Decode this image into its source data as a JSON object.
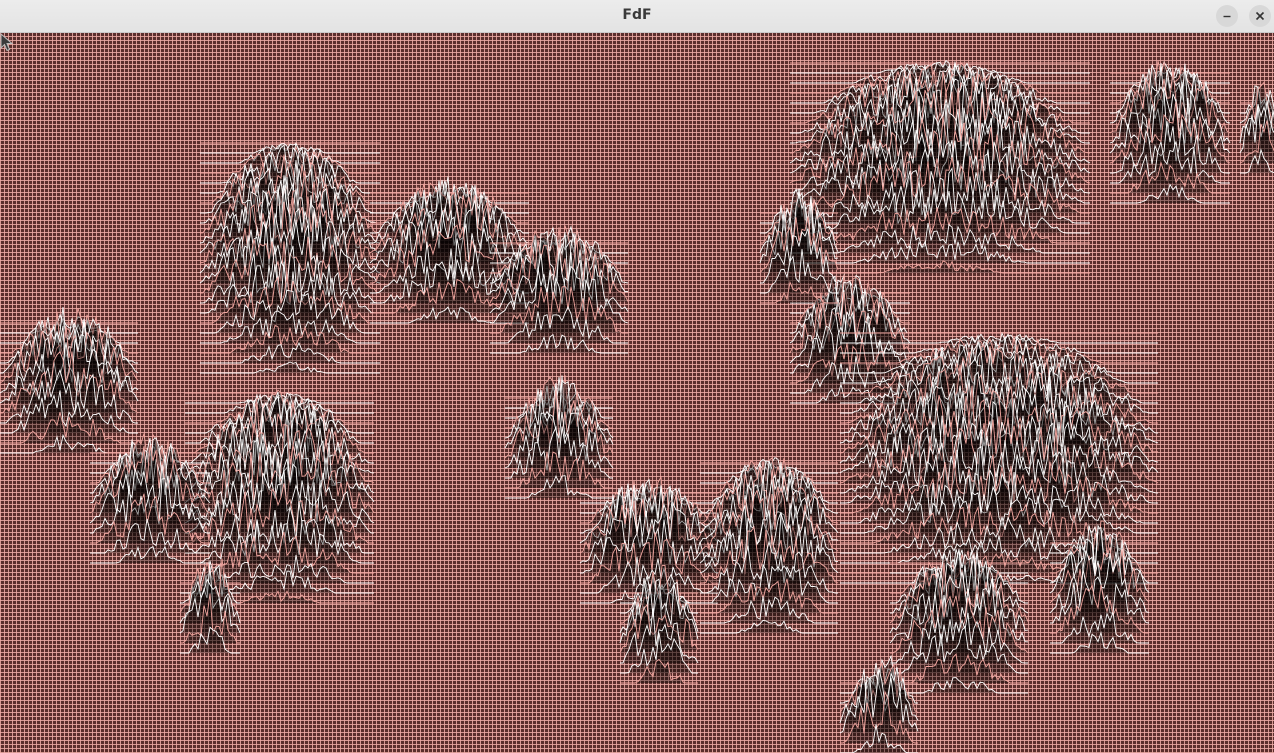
{
  "window": {
    "title": "FdF",
    "minimize_icon": "minimize-icon",
    "close_icon": "close-icon"
  },
  "render": {
    "background_color": "#5a2e2c",
    "grid_color": "#ecaaa5",
    "peak_color": "#ffffff",
    "peak_edge_color": "#f3a7a0",
    "valley_color": "#000000"
  },
  "cursor": {
    "icon": "pointer-arrow-icon"
  }
}
